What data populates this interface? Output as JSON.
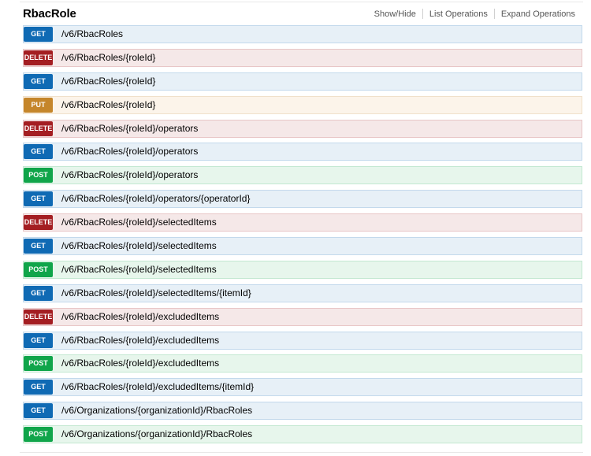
{
  "resource": {
    "title": "RbacRole",
    "options": {
      "show_hide": "Show/Hide",
      "list_operations": "List Operations",
      "expand_operations": "Expand Operations"
    }
  },
  "colors": {
    "get": "#0f6ab4",
    "delete": "#a41e22",
    "put": "#c5862b",
    "post": "#10a54a"
  },
  "operations": [
    {
      "method": "GET",
      "path": "/v6/RbacRoles"
    },
    {
      "method": "DELETE",
      "path": "/v6/RbacRoles/{roleId}"
    },
    {
      "method": "GET",
      "path": "/v6/RbacRoles/{roleId}"
    },
    {
      "method": "PUT",
      "path": "/v6/RbacRoles/{roleId}"
    },
    {
      "method": "DELETE",
      "path": "/v6/RbacRoles/{roleId}/operators"
    },
    {
      "method": "GET",
      "path": "/v6/RbacRoles/{roleId}/operators"
    },
    {
      "method": "POST",
      "path": "/v6/RbacRoles/{roleId}/operators"
    },
    {
      "method": "GET",
      "path": "/v6/RbacRoles/{roleId}/operators/{operatorId}"
    },
    {
      "method": "DELETE",
      "path": "/v6/RbacRoles/{roleId}/selectedItems"
    },
    {
      "method": "GET",
      "path": "/v6/RbacRoles/{roleId}/selectedItems"
    },
    {
      "method": "POST",
      "path": "/v6/RbacRoles/{roleId}/selectedItems"
    },
    {
      "method": "GET",
      "path": "/v6/RbacRoles/{roleId}/selectedItems/{itemId}"
    },
    {
      "method": "DELETE",
      "path": "/v6/RbacRoles/{roleId}/excludedItems"
    },
    {
      "method": "GET",
      "path": "/v6/RbacRoles/{roleId}/excludedItems"
    },
    {
      "method": "POST",
      "path": "/v6/RbacRoles/{roleId}/excludedItems"
    },
    {
      "method": "GET",
      "path": "/v6/RbacRoles/{roleId}/excludedItems/{itemId}"
    },
    {
      "method": "GET",
      "path": "/v6/Organizations/{organizationId}/RbacRoles"
    },
    {
      "method": "POST",
      "path": "/v6/Organizations/{organizationId}/RbacRoles"
    }
  ]
}
